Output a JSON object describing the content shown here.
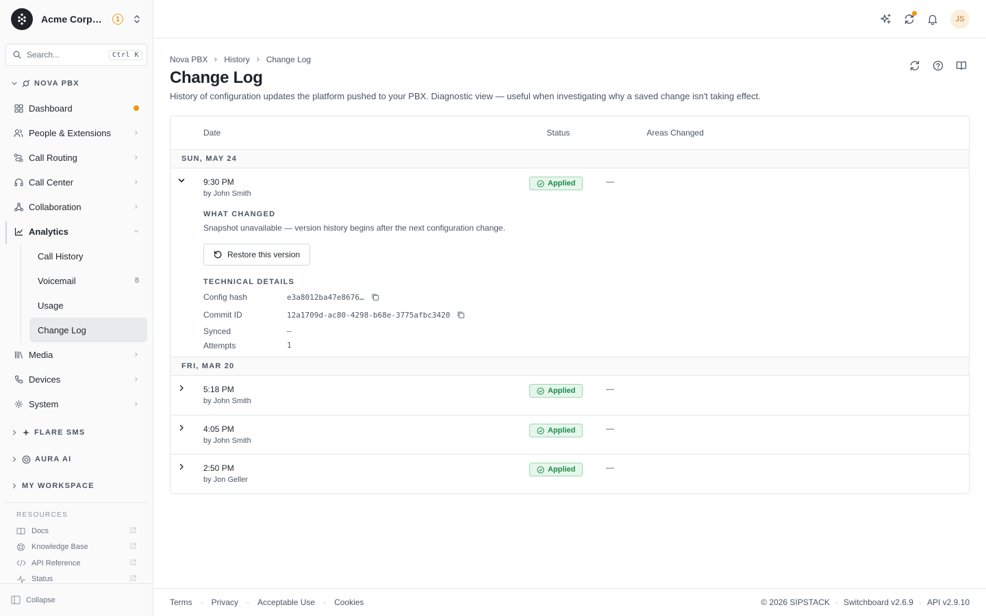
{
  "org": {
    "name": "Acme Corporation",
    "badge": "1"
  },
  "search": {
    "placeholder": "Search...",
    "shortcut": "Ctrl K"
  },
  "nav": {
    "section_nova": "NOVA PBX",
    "items": [
      {
        "label": "Dashboard",
        "icon": "grid-icon"
      },
      {
        "label": "People & Extensions",
        "icon": "people-icon"
      },
      {
        "label": "Call Routing",
        "icon": "routing-icon"
      },
      {
        "label": "Call Center",
        "icon": "headset-icon"
      },
      {
        "label": "Collaboration",
        "icon": "collab-icon"
      },
      {
        "label": "Analytics",
        "icon": "chart-icon"
      }
    ],
    "analytics_sub": [
      {
        "label": "Call History"
      },
      {
        "label": "Voicemail",
        "count": "8"
      },
      {
        "label": "Usage"
      },
      {
        "label": "Change Log"
      }
    ],
    "items_after": [
      {
        "label": "Media"
      },
      {
        "label": "Devices"
      },
      {
        "label": "System"
      }
    ],
    "section_flare": "FLARE SMS",
    "section_aura": "AURA AI",
    "section_workspace": "MY WORKSPACE"
  },
  "resources": {
    "title": "RESOURCES",
    "items": [
      "Docs",
      "Knowledge Base",
      "API Reference",
      "Status"
    ]
  },
  "collapse_label": "Collapse",
  "topbar": {
    "avatar": "JS"
  },
  "breadcrumb": [
    "Nova PBX",
    "History",
    "Change Log"
  ],
  "page": {
    "title": "Change Log",
    "subtitle": "History of configuration updates the platform pushed to your PBX. Diagnostic view — useful when investigating why a saved change isn't taking effect."
  },
  "table": {
    "headers": {
      "date": "Date",
      "status": "Status",
      "areas": "Areas Changed"
    },
    "groups": [
      {
        "label": "SUN, MAY 24",
        "rows": [
          {
            "time": "9:30 PM",
            "by": "by John Smith",
            "status": "Applied",
            "areas": "—",
            "expanded": true,
            "detail": {
              "what_label": "WHAT CHANGED",
              "what_text": "Snapshot unavailable — version history begins after the next configuration change.",
              "restore_label": "Restore this version",
              "tech_label": "TECHNICAL DETAILS",
              "config_hash_key": "Config hash",
              "config_hash": "e3a8012ba47e8676…",
              "commit_key": "Commit ID",
              "commit": "12a1709d-ac80-4298-b68e-3775afbc3420",
              "synced_key": "Synced",
              "synced": "—",
              "attempts_key": "Attempts",
              "attempts": "1"
            }
          }
        ]
      },
      {
        "label": "FRI, MAR 20",
        "rows": [
          {
            "time": "5:18 PM",
            "by": "by John Smith",
            "status": "Applied",
            "areas": "—"
          },
          {
            "time": "4:05 PM",
            "by": "by John Smith",
            "status": "Applied",
            "areas": "—"
          },
          {
            "time": "2:50 PM",
            "by": "by Jon Geller",
            "status": "Applied",
            "areas": "—"
          }
        ]
      }
    ]
  },
  "footer": {
    "links": [
      "Terms",
      "Privacy",
      "Acceptable Use",
      "Cookies"
    ],
    "copyright": "© 2026 SIPSTACK",
    "version": "Switchboard v2.6.9",
    "api": "API v2.9.10"
  },
  "colors": {
    "accent_dot": "#f0960c",
    "applied_green": "#1f8a4c",
    "applied_bg": "#e6f6ec"
  }
}
